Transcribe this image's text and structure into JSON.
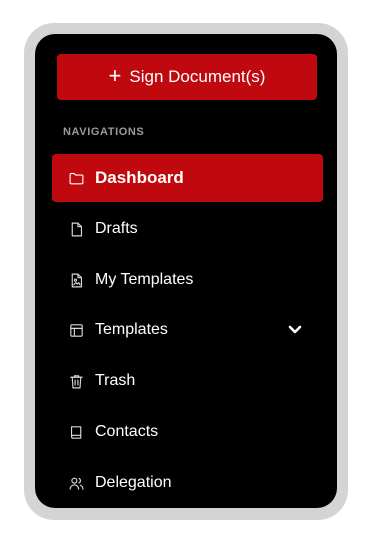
{
  "sign_button": {
    "plus": "+",
    "label": "Sign Document(s)"
  },
  "section_label": "NAVIGATIONS",
  "nav": {
    "items": [
      {
        "label": "Dashboard",
        "icon": "folder-icon",
        "active": true
      },
      {
        "label": "Drafts",
        "icon": "file-icon",
        "active": false
      },
      {
        "label": "My Templates",
        "icon": "file-image-icon",
        "active": false
      },
      {
        "label": "Templates",
        "icon": "table-icon",
        "active": false,
        "expandable": true
      },
      {
        "label": "Trash",
        "icon": "trash-icon",
        "active": false
      },
      {
        "label": "Contacts",
        "icon": "book-icon",
        "active": false
      },
      {
        "label": "Delegation",
        "icon": "users-icon",
        "active": false
      }
    ]
  },
  "colors": {
    "accent": "#c0090e",
    "panel_bg": "#000000",
    "frame_bg": "#d4d4d4",
    "section_label": "#9a9a9a"
  }
}
